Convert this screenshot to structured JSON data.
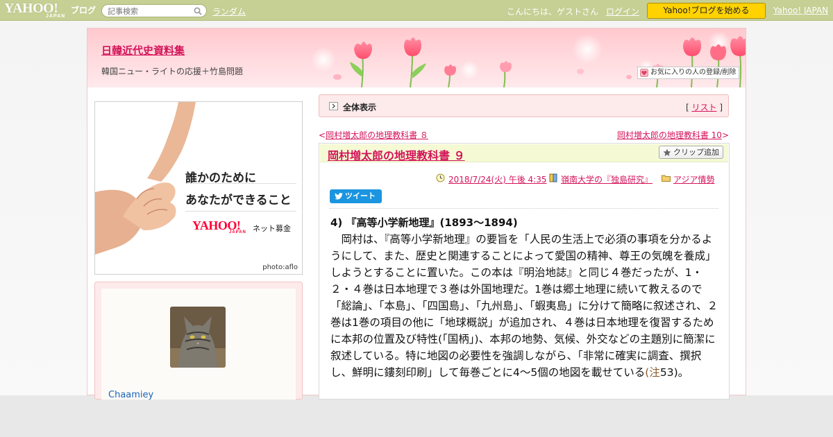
{
  "topbar": {
    "logo_text": "YAHOO!",
    "logo_sub": "JAPAN",
    "logo_blog": "ブログ",
    "search_placeholder": "記事検索",
    "random_link": "ランダム",
    "greeting": "こんにちは、ゲストさん",
    "login_link": "ログイン",
    "start_button": "Yahoo!ブログを始める",
    "yahoo_japan_link": "Yahoo! JAPAN"
  },
  "header": {
    "site_title": "日韓近代史資料集",
    "site_subtitle": "韓国ニュー・ライトの応援＋竹島問題",
    "favorite_button": "お気に入りの人の登録/削除"
  },
  "ad": {
    "line1": "誰かのために",
    "line2": "あなたができること",
    "brand": "YAHOO!",
    "brand_sub": "JAPAN",
    "service": "ネット募金",
    "credit": "photo:aflo"
  },
  "profile": {
    "username": "Chaamiey"
  },
  "listbar": {
    "label": "全体表示",
    "bracket_open": "[",
    "list_link": "リスト",
    "bracket_close": "]"
  },
  "nav": {
    "prev_arrow": "<",
    "prev_title": "岡村増太郎の地理教科書 ８",
    "next_title": "岡村増太郎の地理教科書 10",
    "next_arrow": ">"
  },
  "article": {
    "title": "岡村増太郎の地理教科書 ９",
    "clip_button": "クリップ追加",
    "date": "2018/7/24(火) 午後 4:35",
    "book": "嶺南大学の『独島研究』",
    "category": "アジア情勢",
    "tweet_button": "ツイート",
    "heading": "4) 『高等小学新地理』(1893～1894)",
    "paragraph": "　岡村は、『高等小学新地理』の要旨を「人民の生活上で必須の事項を分かるようにして、また、歴史と関連することによって愛国の精神、尊王の気魄を養成」しようとすることに置いた。この本は『明治地誌』と同じ４巻だったが、1・２・４巻は日本地理で３巻は外国地理だ。1巻は郷土地理に続いて教えるので「総論」、「本島」、「四国島」、「九州島」、「蝦夷島」に分けて簡略に叙述され、２巻は1巻の項目の他に「地球概説」が追加され、４巻は日本地理を復習するために本邦の位置及び特性(「国柄」)、本邦の地勢、気候、外交などの主題別に簡潔に叙述している。特に地図の必要性を強調しながら、「非常に確実に調査、撰択し、鮮明に鏤刻印刷」して毎巻ごとに4～5個の地図を載せている",
    "note_open": "(",
    "note_label": "注",
    "note_number": "53",
    "note_close": ")。"
  },
  "colors": {
    "topbar": "#c6cf94",
    "accent": "#d4145a",
    "start_button": "#ffd200",
    "tweet": "#1b95e0",
    "header_pink": "#ffc9cf",
    "title_band": "#f5f9d4"
  },
  "icons": {
    "search": "search-icon",
    "star": "star-icon",
    "heart": "heart-icon",
    "clock": "clock-icon",
    "book": "book-icon",
    "folder": "folder-icon",
    "twitter": "twitter-bird-icon",
    "arrow": "arrow-right-icon"
  }
}
